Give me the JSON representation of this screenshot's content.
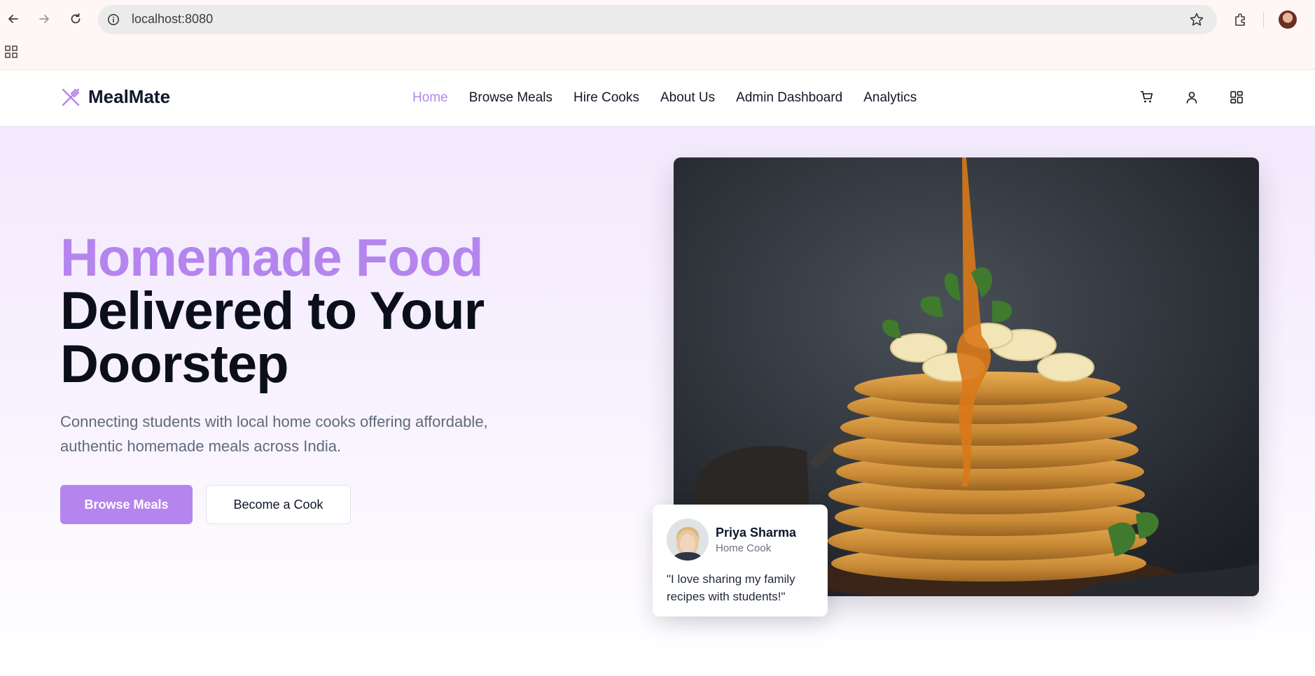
{
  "browser": {
    "url": "localhost:8080"
  },
  "site": {
    "brand": "MealMate",
    "nav": [
      {
        "label": "Home",
        "active": true
      },
      {
        "label": "Browse Meals",
        "active": false
      },
      {
        "label": "Hire Cooks",
        "active": false
      },
      {
        "label": "About Us",
        "active": false
      },
      {
        "label": "Admin Dashboard",
        "active": false
      },
      {
        "label": "Analytics",
        "active": false
      }
    ],
    "header_icons": [
      "cart-icon",
      "user-icon",
      "dashboard-grid-icon"
    ]
  },
  "hero": {
    "title_accent": "Homemade Food",
    "title_line2": "Delivered to Your",
    "title_line3": "Doorstep",
    "subtitle": "Connecting students with local home cooks offering affordable, authentic homemade meals across India.",
    "primary_cta": "Browse Meals",
    "secondary_cta": "Become a Cook"
  },
  "testimonial": {
    "name": "Priya Sharma",
    "role": "Home Cook",
    "quote": "\"I love sharing my family recipes with students!\""
  },
  "colors": {
    "accent": "#b585ee",
    "dark_text": "#0b0f1c",
    "muted_text": "#5f6b7d"
  }
}
